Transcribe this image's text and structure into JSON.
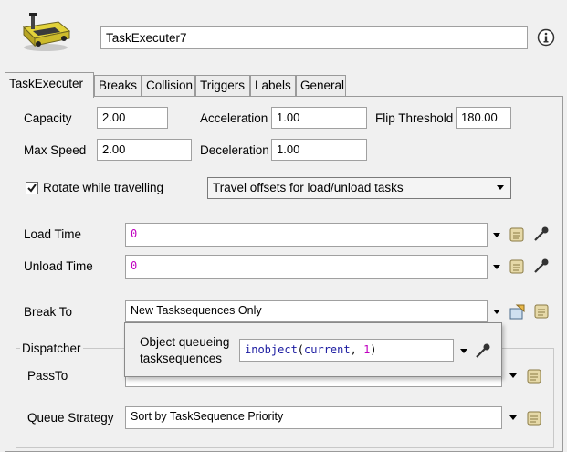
{
  "header": {
    "name_value": "TaskExecuter7",
    "icons": {
      "object": "task-executer-forklift-icon",
      "info": "info-icon"
    }
  },
  "tabs": [
    {
      "label": "TaskExecuter",
      "active": true
    },
    {
      "label": "Breaks",
      "active": false
    },
    {
      "label": "Collision",
      "active": false
    },
    {
      "label": "Triggers",
      "active": false
    },
    {
      "label": "Labels",
      "active": false
    },
    {
      "label": "General",
      "active": false
    }
  ],
  "props": {
    "capacity_label": "Capacity",
    "capacity_value": "2.00",
    "acceleration_label": "Acceleration",
    "acceleration_value": "1.00",
    "flip_label": "Flip Threshold",
    "flip_value": "180.00",
    "maxspeed_label": "Max Speed",
    "maxspeed_value": "2.00",
    "deceleration_label": "Deceleration",
    "deceleration_value": "1.00"
  },
  "rotate": {
    "label": "Rotate while travelling",
    "checked": true
  },
  "offsets": {
    "selected": "Travel offsets for load/unload tasks"
  },
  "load": {
    "label": "Load Time",
    "value": "0"
  },
  "unload": {
    "label": "Unload Time",
    "value": "0"
  },
  "breakto": {
    "label": "Break To",
    "value": "New Tasksequences Only"
  },
  "dispatcher": {
    "group_label": "Dispatcher",
    "passto_label": "PassTo",
    "queue_label": "Queue Strategy",
    "queue_value": "Sort by TaskSequence Priority"
  },
  "popup": {
    "label_line1": "Object queueing",
    "label_line2": "tasksequences",
    "code_func": "inobject",
    "code_open": "(",
    "code_arg1": "current",
    "code_sep": ", ",
    "code_arg2": "1",
    "code_close": ")"
  },
  "colors": {
    "code_function": "#1a1aa0",
    "code_keyword": "#1a1aa0",
    "code_number": "#c000c0",
    "accent": "#1a3a8a"
  }
}
